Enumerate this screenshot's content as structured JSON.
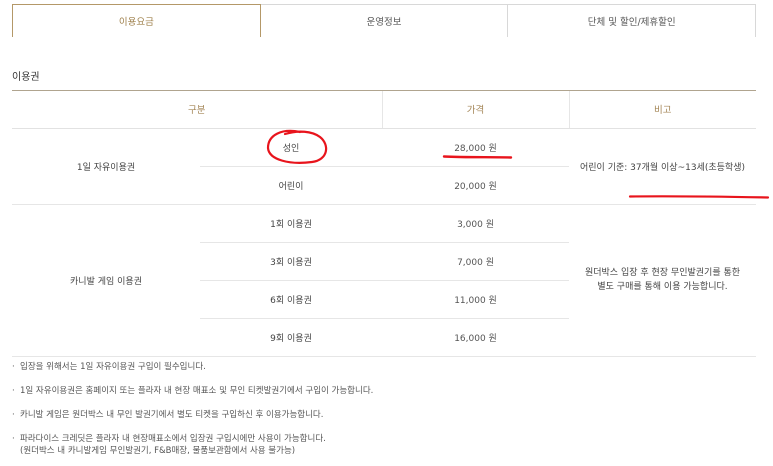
{
  "tabs": [
    {
      "label": "이용요금",
      "active": true
    },
    {
      "label": "운영정보",
      "active": false
    },
    {
      "label": "단체 및 할인/제휴할인",
      "active": false
    }
  ],
  "section_title": "이용권",
  "table": {
    "headers": {
      "category": "구분",
      "price": "가격",
      "note": "비고"
    },
    "day_pass": {
      "label": "1일 자유이용권",
      "rows": [
        {
          "type": "성인",
          "price": "28,000 원"
        },
        {
          "type": "어린이",
          "price": "20,000 원"
        }
      ],
      "note": "어린이 기준: 37개월 이상~13세(초등학생)"
    },
    "game_pass": {
      "label": "카니발 게임 이용권",
      "rows": [
        {
          "type": "1회 이용권",
          "price": "3,000 원"
        },
        {
          "type": "3회 이용권",
          "price": "7,000 원"
        },
        {
          "type": "6회 이용권",
          "price": "11,000 원"
        },
        {
          "type": "9회 이용권",
          "price": "16,000 원"
        }
      ],
      "note_line1": "원더박스 입장 후 현장 무인발권기를 통한",
      "note_line2": "별도 구매를 통해 이용 가능합니다."
    }
  },
  "notes": [
    "입장을 위해서는 1일 자유이용권 구입이 필수입니다.",
    "1일 자유이용권은 홈페이지 또는 플라자 내 현장 매표소 및 무인 티켓발권기에서 구입이 가능합니다.",
    "카니발 게임은 원더박스 내 무인 발권기에서 별도 티켓을 구입하신 후 이용가능합니다.",
    "파라다이스 크레딧은 플라자 내 현장매표소에서 입장권 구입시에만 사용이 가능합니다."
  ],
  "note_extra": "(원더박스 내 카니발게임 무인발권기, F&B매장, 물품보관함에서 사용 불가능)",
  "colors": {
    "accent": "#a48657",
    "annotation": "#e8141c"
  }
}
